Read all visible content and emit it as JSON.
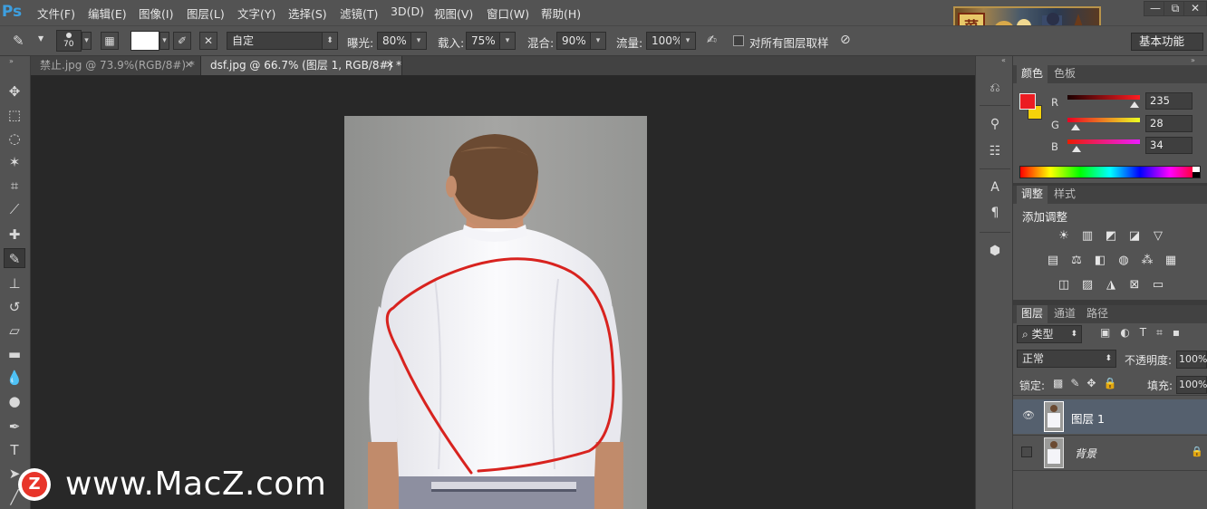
{
  "app": {
    "logo": "Ps",
    "menu": [
      "文件(F)",
      "编辑(E)",
      "图像(I)",
      "图层(L)",
      "文字(Y)",
      "选择(S)",
      "滤镜(T)",
      "3D(D)",
      "视图(V)",
      "窗口(W)",
      "帮助(H)"
    ],
    "banner_seal": "菜",
    "window_controls": [
      "—",
      "⧉",
      "✕"
    ]
  },
  "options": {
    "brush_size": "70",
    "preset": "自定",
    "exposure_label": "曝光:",
    "exposure": "80%",
    "load_label": "载入:",
    "load": "75%",
    "mix_label": "混合:",
    "mix": "90%",
    "flow_label": "流量:",
    "flow": "100%",
    "sample_all_label": "对所有图层取样",
    "workspace": "基本功能"
  },
  "tabs": [
    {
      "label": "禁止.jpg @ 73.9%(RGB/8#) *",
      "close": "✕"
    },
    {
      "label": "dsf.jpg @ 66.7% (图层 1, RGB/8#) *",
      "close": "✕"
    }
  ],
  "color_panel": {
    "tabs": [
      "颜色",
      "色板"
    ],
    "fg": "#EB1C22",
    "bg": "#F5D20A",
    "channels": [
      {
        "label": "R",
        "value": "235",
        "level": 0.92
      },
      {
        "label": "G",
        "value": "28",
        "level": 0.11
      },
      {
        "label": "B",
        "value": "34",
        "level": 0.13
      }
    ]
  },
  "adjust_panel": {
    "tabs": [
      "调整",
      "样式"
    ],
    "title": "添加调整"
  },
  "layers_panel": {
    "tabs": [
      "图层",
      "通道",
      "路径"
    ],
    "filter": "类型",
    "blend_mode": "正常",
    "opacity_label": "不透明度:",
    "opacity": "100%",
    "lock_label": "锁定:",
    "fill_label": "填充:",
    "fill": "100%",
    "layers": [
      {
        "name": "图层 1",
        "visible": true,
        "locked": false,
        "selected": true
      },
      {
        "name": "背景",
        "visible": false,
        "locked": true,
        "selected": false
      }
    ]
  },
  "watermark": {
    "badge": "Z",
    "text": "www.MacZ.com"
  }
}
